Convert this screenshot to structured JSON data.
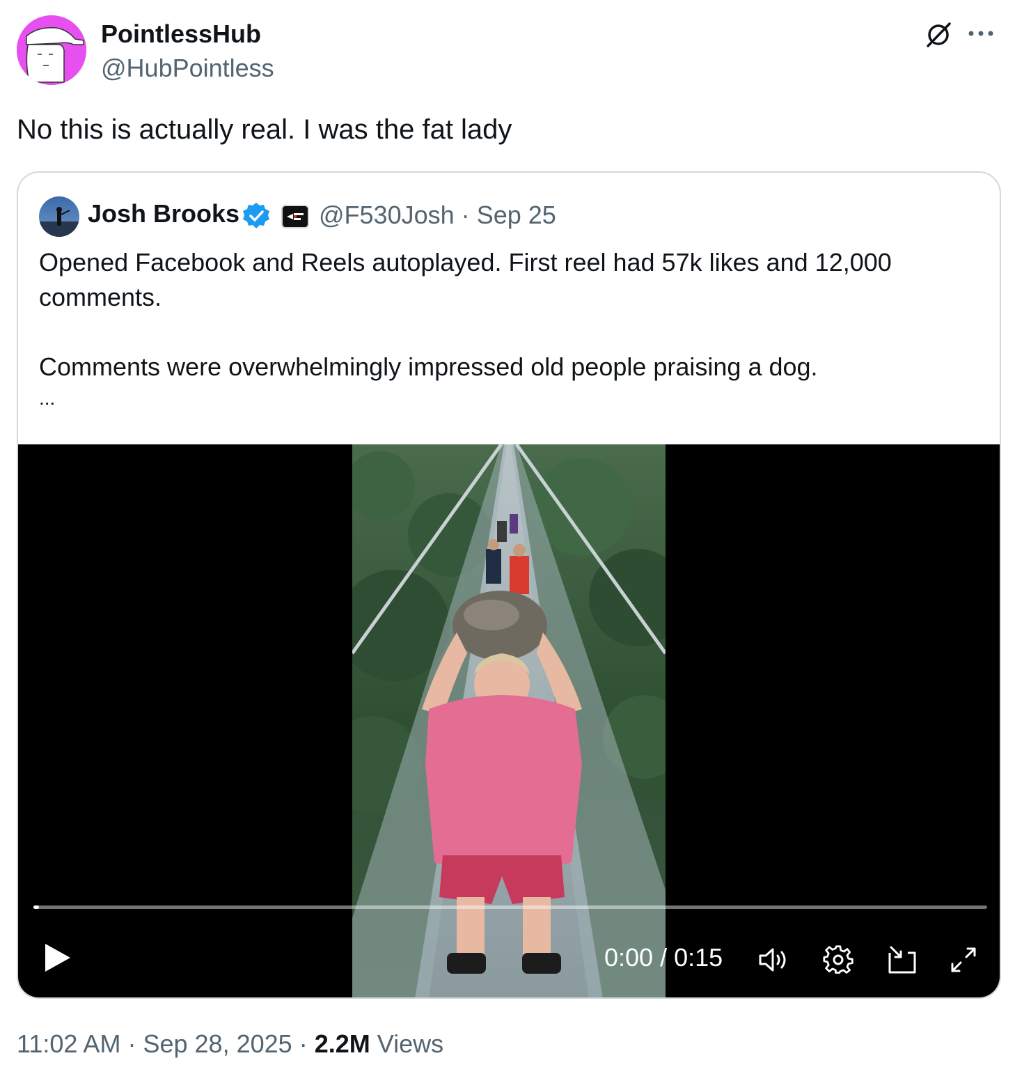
{
  "post": {
    "author_name": "PointlessHub",
    "author_handle": "@HubPointless",
    "text": "No this is actually real. I was the fat lady",
    "time": "11:02 AM",
    "date": "Sep 28, 2025",
    "views_count": "2.2M",
    "views_label": "Views",
    "separator": "·",
    "avatar_color": "#e84ff0"
  },
  "quoted": {
    "author_name": "Josh Brooks",
    "handle": "@F530Josh",
    "separator": "·",
    "date": "Sep 25",
    "verified_color": "#1d9bf0",
    "paragraph1": "Opened Facebook and Reels autoplayed. First reel had 57k likes and 12,000 comments.",
    "paragraph2": "Comments were overwhelmingly impressed old people praising a dog.",
    "truncation": "..."
  },
  "video": {
    "current_time": "0:00",
    "time_separator": "/",
    "duration": "0:15",
    "progress": 0.005,
    "controls": [
      "play-icon",
      "volume-icon",
      "settings-icon",
      "pip-icon",
      "fullscreen-icon"
    ]
  }
}
